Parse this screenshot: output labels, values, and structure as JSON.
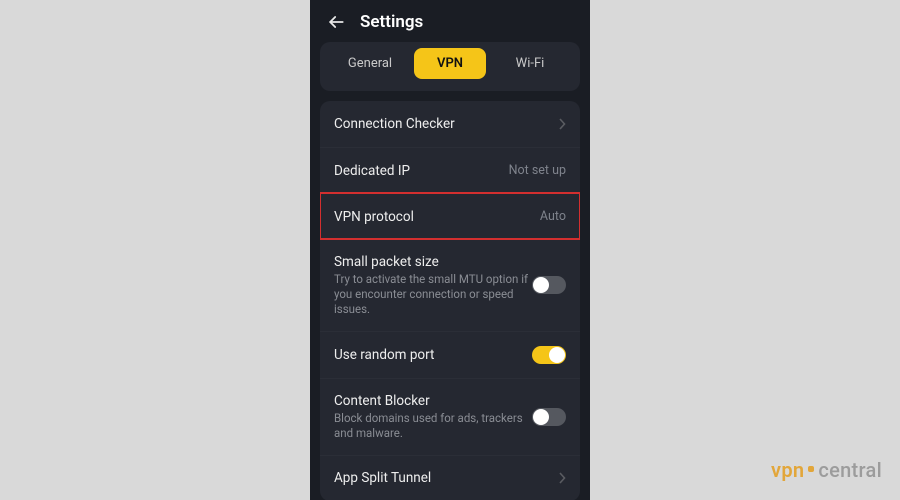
{
  "header": {
    "title": "Settings"
  },
  "tabs": {
    "general": "General",
    "vpn": "VPN",
    "wifi": "Wi-Fi",
    "active": "vpn"
  },
  "rows": {
    "connection_checker": {
      "title": "Connection Checker"
    },
    "dedicated_ip": {
      "title": "Dedicated IP",
      "value": "Not set up"
    },
    "vpn_protocol": {
      "title": "VPN protocol",
      "value": "Auto"
    },
    "small_packet": {
      "title": "Small packet size",
      "desc": "Try to activate the small MTU option if you encounter connection or speed issues.",
      "on": false
    },
    "random_port": {
      "title": "Use random port",
      "on": true
    },
    "content_blocker": {
      "title": "Content Blocker",
      "desc": "Block domains used for ads, trackers and malware.",
      "on": false
    },
    "split_tunnel": {
      "title": "App Split Tunnel"
    }
  },
  "watermark": {
    "left": "vpn",
    "right": "central"
  },
  "colors": {
    "accent": "#f5c518",
    "highlight": "#d32f2f"
  }
}
